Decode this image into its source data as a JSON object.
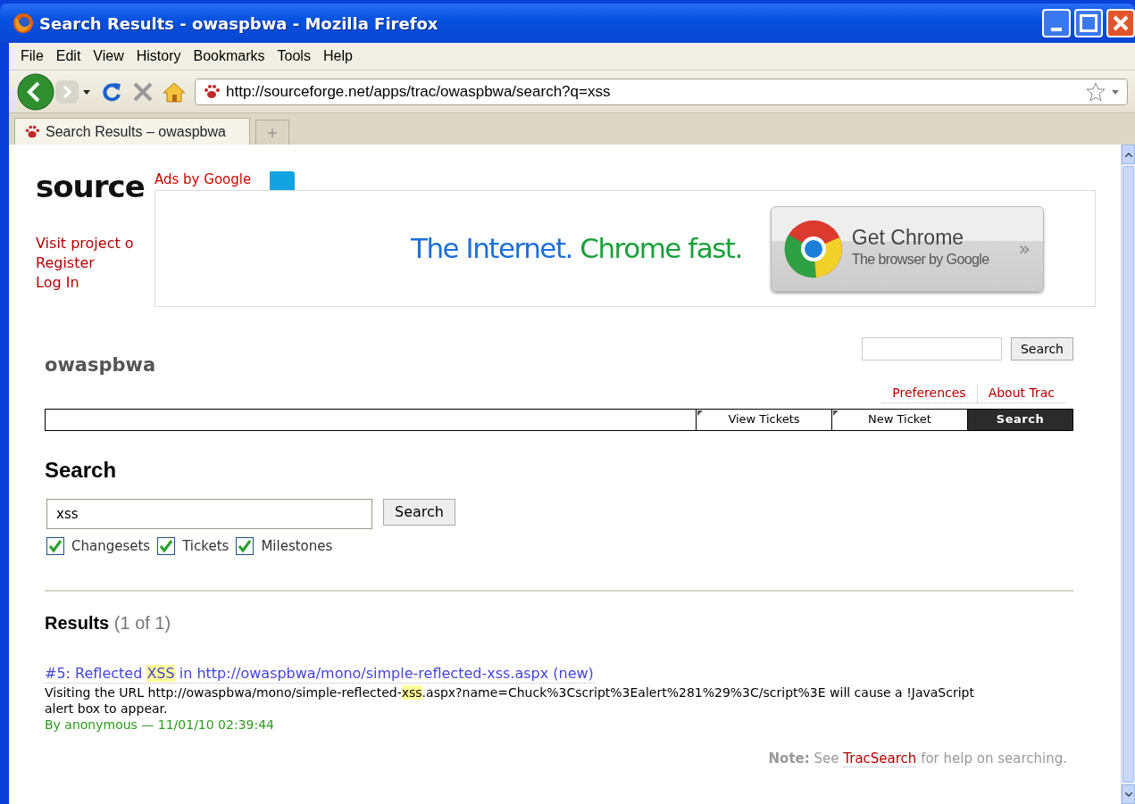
{
  "window": {
    "title": "Search Results - owaspbwa - Mozilla Firefox"
  },
  "menu": [
    {
      "label": "File"
    },
    {
      "label": "Edit"
    },
    {
      "label": "View"
    },
    {
      "label": "History"
    },
    {
      "label": "Bookmarks"
    },
    {
      "label": "Tools"
    },
    {
      "label": "Help"
    }
  ],
  "address": "http://sourceforge.net/apps/trac/owaspbwa/search?q=xss",
  "tabs": [
    {
      "label": "Search Results – owaspbwa",
      "selected": true
    }
  ],
  "logo": "source",
  "site_links": [
    "Visit project o",
    "Register",
    "Log In"
  ],
  "ad": {
    "label": "Ads by Google",
    "headline": "The Internet.",
    "headline_accent": "Chrome fast.",
    "button_title": "Get Chrome",
    "button_subtitle": "The browser by Google",
    "button_chevron": "»"
  },
  "project": "owaspbwa",
  "quick_search": {
    "button": "Search"
  },
  "metanav": [
    "Preferences",
    "About Trac"
  ],
  "mainnav": [
    {
      "label": "View Tickets",
      "selected": false
    },
    {
      "label": "New Ticket",
      "selected": false
    },
    {
      "label": "Search",
      "selected": true
    }
  ],
  "search": {
    "heading": "Search",
    "value": "xss",
    "button": "Search",
    "filters": [
      {
        "label": "Changesets",
        "checked": true
      },
      {
        "label": "Tickets",
        "checked": true
      },
      {
        "label": "Milestones",
        "checked": true
      }
    ]
  },
  "results": {
    "heading": "Results",
    "count": "(1 of 1)",
    "items": [
      {
        "title": [
          {
            "text": "#5: Reflected ",
            "highlight": false
          },
          {
            "text": "XSS",
            "highlight": true
          },
          {
            "text": " in http://owaspbwa/mono/simple-reflected-xss.aspx (new)",
            "highlight": false
          }
        ],
        "excerpt": [
          {
            "text": "Visiting the URL http://owaspbwa/mono/simple-reflected-",
            "highlight": false
          },
          {
            "text": "xss",
            "highlight": true
          },
          {
            "text": ".aspx?name=Chuck%3Cscript%3Ealert%281%29%3C/script%3E will cause a !JavaScript alert box to appear.",
            "highlight": false
          }
        ],
        "meta": "By anonymous — 11/01/10 02:39:44"
      }
    ]
  },
  "note": {
    "prefix": "**Note:** See ",
    "link": "TracSearch",
    "suffix": " for help on searching."
  }
}
